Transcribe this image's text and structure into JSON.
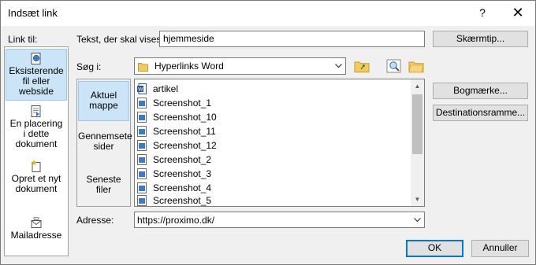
{
  "window": {
    "title": "Indsæt link",
    "help_label": "?",
    "close_label": "✕"
  },
  "sidebar": {
    "heading": "Link til:",
    "items": [
      {
        "label": "Eksisterende fil eller webside",
        "icon": "existing-file-web-icon",
        "active": true
      },
      {
        "label": "En placering i dette dokument",
        "icon": "place-in-document-icon",
        "active": false
      },
      {
        "label": "Opret et nyt dokument",
        "icon": "new-document-icon",
        "active": false
      },
      {
        "label": "Mailadresse",
        "icon": "email-address-icon",
        "active": false
      }
    ]
  },
  "text_to_display": {
    "label": "Tekst, der skal vises:",
    "value": "hjemmeside"
  },
  "screentip_button": "Skærmtip...",
  "look_in": {
    "label": "Søg i:",
    "value": "Hyperlinks Word"
  },
  "browse_nav": {
    "items": [
      {
        "label": "Aktuel mappe",
        "active": true
      },
      {
        "label": "Gennemsete sider",
        "active": false
      },
      {
        "label": "Seneste filer",
        "active": false
      }
    ]
  },
  "files": [
    {
      "name": "artikel",
      "type": "word-document-icon"
    },
    {
      "name": "Screenshot_1",
      "type": "image-file-icon"
    },
    {
      "name": "Screenshot_10",
      "type": "image-file-icon"
    },
    {
      "name": "Screenshot_11",
      "type": "image-file-icon"
    },
    {
      "name": "Screenshot_12",
      "type": "image-file-icon"
    },
    {
      "name": "Screenshot_2",
      "type": "image-file-icon"
    },
    {
      "name": "Screenshot_3",
      "type": "image-file-icon"
    },
    {
      "name": "Screenshot_4",
      "type": "image-file-icon"
    },
    {
      "name": "Screenshot_5",
      "type": "image-file-icon"
    }
  ],
  "right_buttons": {
    "bookmark": "Bogmærke...",
    "target_frame": "Destinationsramme..."
  },
  "address": {
    "label": "Adresse:",
    "value": "https://proximo.dk/"
  },
  "footer": {
    "ok": "OK",
    "cancel": "Annuller"
  },
  "colors": {
    "selection_bg": "#cce4f7",
    "selection_border": "#99c9ef",
    "default_button_border": "#0078d7",
    "folder_yellow": "#e8b84a",
    "word_blue": "#2b579a"
  }
}
